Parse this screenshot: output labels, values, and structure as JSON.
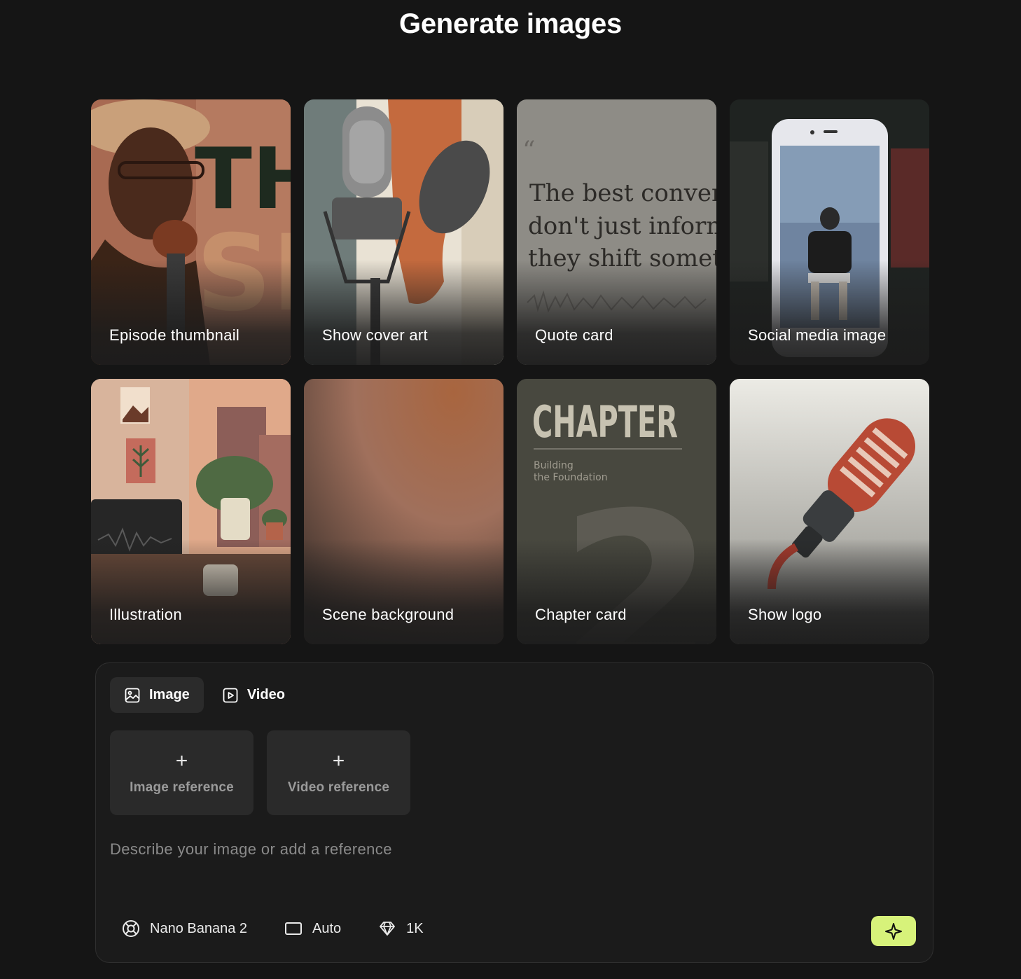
{
  "page": {
    "title": "Generate images"
  },
  "templates": [
    {
      "id": "episode-thumbnail",
      "label": "Episode thumbnail"
    },
    {
      "id": "show-cover-art",
      "label": "Show cover art"
    },
    {
      "id": "quote-card",
      "label": "Quote card",
      "art_text": [
        "The best conversa",
        "don't just inform,",
        "they shift somethi"
      ]
    },
    {
      "id": "social-media-image",
      "label": "Social media image"
    },
    {
      "id": "illustration",
      "label": "Illustration"
    },
    {
      "id": "scene-background",
      "label": "Scene background"
    },
    {
      "id": "chapter-card",
      "label": "Chapter card",
      "art_text": {
        "heading": "CHAPTER",
        "subtitle_line1": "Building",
        "subtitle_line2": "the Foundation",
        "number": "2"
      }
    },
    {
      "id": "show-logo",
      "label": "Show logo"
    }
  ],
  "composer": {
    "tabs": [
      {
        "label": "Image",
        "icon": "image-icon",
        "active": true
      },
      {
        "label": "Video",
        "icon": "video-icon",
        "active": false
      }
    ],
    "references": [
      {
        "label": "Image reference",
        "icon": "plus-icon"
      },
      {
        "label": "Video reference",
        "icon": "plus-icon"
      }
    ],
    "prompt": {
      "placeholder": "Describe your image or add a reference",
      "value": ""
    },
    "options": [
      {
        "label": "Nano Banana 2",
        "icon": "model-icon"
      },
      {
        "label": "Auto",
        "icon": "aspect-ratio-icon"
      },
      {
        "label": "1K",
        "icon": "diamond-icon"
      }
    ],
    "generate": {
      "icon": "sparkle-icon",
      "color": "#d7f27a"
    }
  },
  "colors": {
    "background": "#151515",
    "panel": "#1b1b1b",
    "accent": "#d7f27a"
  }
}
